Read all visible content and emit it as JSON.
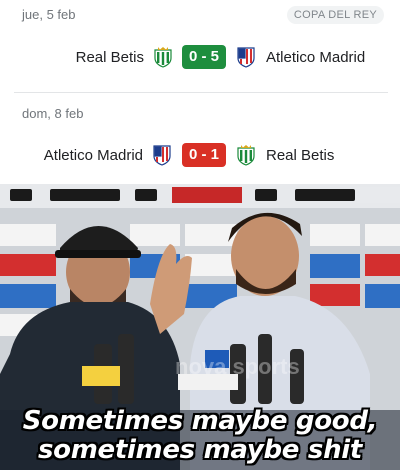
{
  "matches": [
    {
      "date": "jue, 5 feb",
      "competition": "COPA DEL REY",
      "home": "Real Betis",
      "away": "Atletico Madrid",
      "score": "0 - 5",
      "score_color": "#1e8e3e"
    },
    {
      "date": "dom, 8 feb",
      "home": "Atletico Madrid",
      "away": "Real Betis",
      "score": "0 - 1",
      "score_color": "#d93025"
    }
  ],
  "meme": {
    "sponsor_text": "nova sports",
    "caption_line1": "Sometimes maybe good,",
    "caption_line2": "sometimes maybe shit"
  },
  "icons": {
    "betis": "betis-crest-icon",
    "atletico": "atletico-crest-icon"
  }
}
